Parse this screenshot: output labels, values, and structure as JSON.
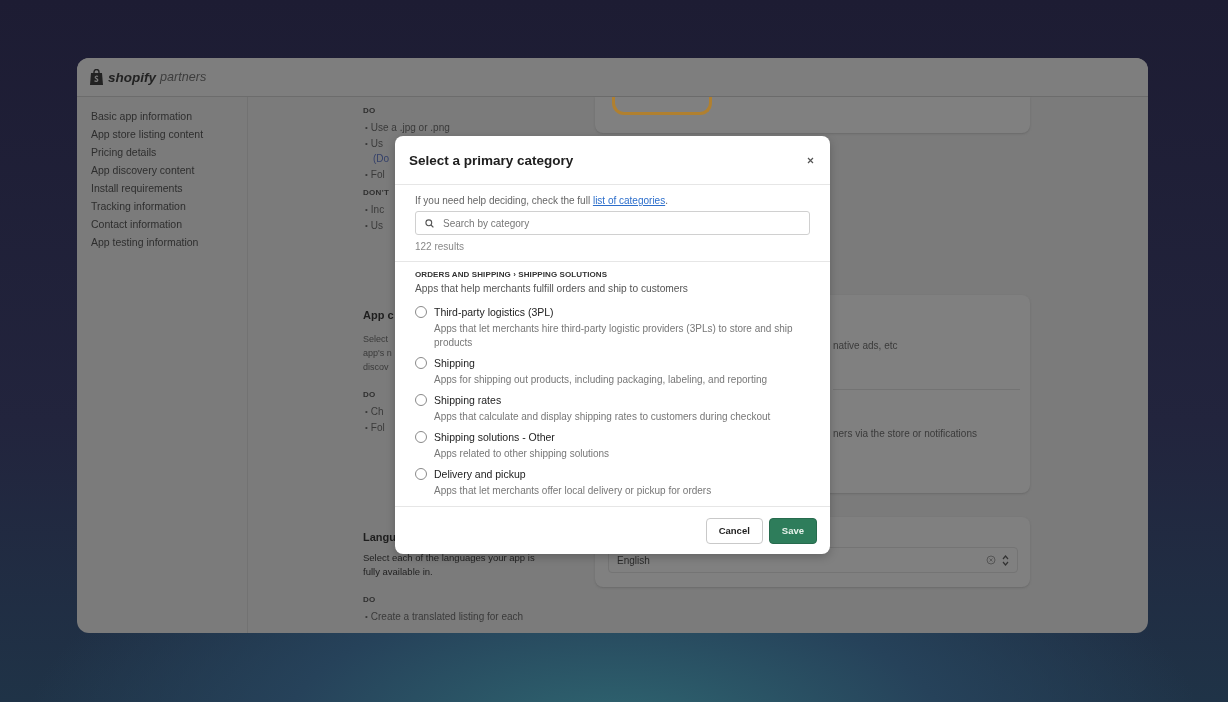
{
  "brand": {
    "name": "shopify",
    "suffix": "partners"
  },
  "sidebar": {
    "items": [
      {
        "label": "Basic app information"
      },
      {
        "label": "App store listing content"
      },
      {
        "label": "Pricing details"
      },
      {
        "label": "App discovery content"
      },
      {
        "label": "Install requirements"
      },
      {
        "label": "Tracking information"
      },
      {
        "label": "Contact information"
      },
      {
        "label": "App testing information"
      }
    ]
  },
  "content_sections": [
    {
      "items": [
        {
          "kind": "label",
          "text": "DO"
        },
        {
          "kind": "bullet",
          "marker": "•",
          "text": "Use a .jpg or .png"
        },
        {
          "kind": "bullet",
          "marker": "•",
          "text": "Us"
        },
        {
          "kind": "link",
          "text": "(Do"
        },
        {
          "kind": "bullet",
          "marker": "•",
          "text": "Fol"
        },
        {
          "kind": "label",
          "text": "DON'T"
        },
        {
          "kind": "bullet",
          "marker": "•",
          "text": "Inc"
        },
        {
          "kind": "bullet",
          "marker": "•",
          "text": "Us"
        }
      ]
    },
    {
      "items": [
        {
          "kind": "heading",
          "text": "App c"
        },
        {
          "kind": "line",
          "text": "Select"
        },
        {
          "kind": "line",
          "text": "app's n"
        },
        {
          "kind": "line",
          "text": "discov"
        },
        {
          "kind": "label",
          "text": "DO"
        },
        {
          "kind": "bullet",
          "marker": "•",
          "text": "Ch"
        },
        {
          "kind": "bullet",
          "marker": "•",
          "text": "Fol"
        }
      ]
    },
    {
      "items": [
        {
          "kind": "heading",
          "text": "Langu"
        },
        {
          "kind": "line",
          "text": "Select each of the languages your app is fully available in."
        },
        {
          "kind": "label",
          "text": "DO"
        },
        {
          "kind": "bullet",
          "marker": "•",
          "text": "Create a translated listing for each"
        }
      ]
    }
  ],
  "cards": [
    {
      "kind": "image"
    },
    {
      "kind": "text",
      "lines": [
        "native ads, etc",
        "ners via the store or notifications"
      ]
    },
    {
      "kind": "select",
      "value": "English"
    }
  ],
  "modal": {
    "title": "Select a primary category",
    "help": "If you need help deciding, check the full ",
    "help_link": "list of categories",
    "help_end": ".",
    "search": {
      "placeholder": "Search by category"
    },
    "results": "122 results",
    "group": {
      "title": "ORDERS AND SHIPPING › SHIPPING SOLUTIONS",
      "description": "Apps that help merchants fulfill orders and ship to customers"
    },
    "options": [
      {
        "title": "Third-party logistics (3PL)",
        "description": "Apps that let merchants hire third-party logistic providers (3PLs) to store and ship products",
        "selected": false
      },
      {
        "title": "Shipping",
        "description": "Apps for shipping out products, including packaging, labeling, and reporting",
        "selected": false
      },
      {
        "title": "Shipping rates",
        "description": "Apps that calculate and display shipping rates to customers during checkout",
        "selected": false
      },
      {
        "title": "Shipping solutions - Other",
        "description": "Apps related to other shipping solutions",
        "selected": false
      },
      {
        "title": "Delivery and pickup",
        "description": "Apps that let merchants offer local delivery or pickup for orders",
        "selected": false
      }
    ],
    "buttons": [
      {
        "kind": "secondary",
        "label": "Cancel"
      },
      {
        "kind": "primary",
        "label": "Save"
      }
    ]
  }
}
